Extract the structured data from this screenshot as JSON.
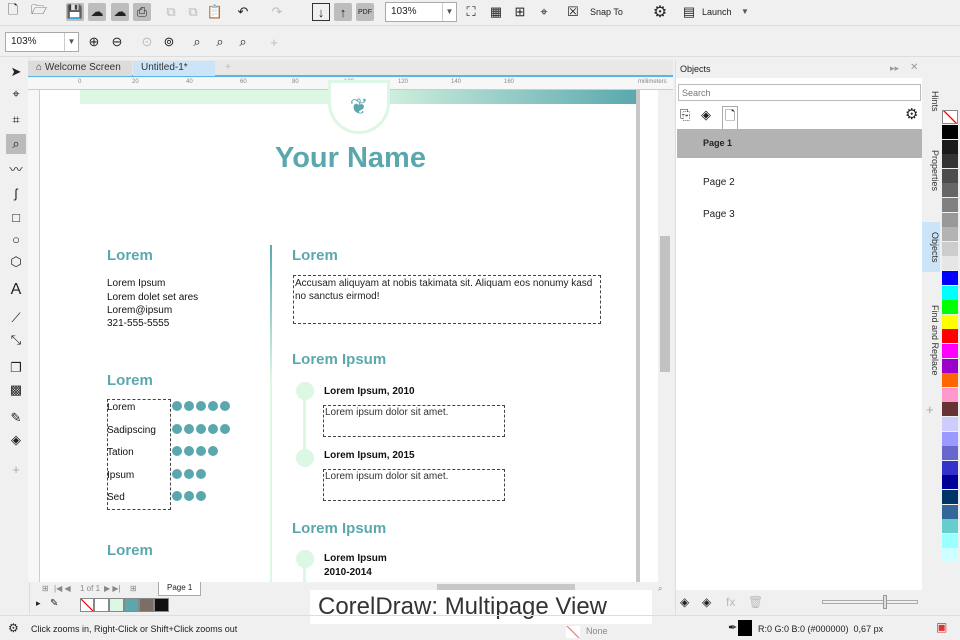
{
  "toolbar": {
    "zoom_value": "103%",
    "snap_to": "Snap To",
    "launch": "Launch",
    "pdf": "PDF"
  },
  "zoombar": {
    "zoom_value": "103%"
  },
  "tabs": [
    {
      "label": "Welcome Screen"
    },
    {
      "label": "Untitled-1*"
    }
  ],
  "ruler": {
    "ticks": [
      "0",
      "20",
      "40",
      "60",
      "80",
      "100",
      "120",
      "140",
      "160"
    ],
    "unit": "millimeters"
  },
  "doc": {
    "name": "Your Name",
    "left_heading1": "Lorem",
    "contact": [
      "Lorem Ipsum",
      "Lorem dolet set ares",
      "Lorem@ipsum",
      "321-555-5555"
    ],
    "left_heading2": "Lorem",
    "skills": [
      {
        "label": "Lorem",
        "level": 5
      },
      {
        "label": "Sadipscing",
        "level": 5
      },
      {
        "label": "Tation",
        "level": 4
      },
      {
        "label": "Ipsum",
        "level": 3
      },
      {
        "label": "Sed",
        "level": 3
      }
    ],
    "left_heading3": "Lorem",
    "right_heading1": "Lorem",
    "intro": "Accusam aliquyam at nobis takimata sit. Aliquam eos nonumy kasd no sanctus eirmod!",
    "right_heading2": "Lorem Ipsum",
    "entries": [
      {
        "title": "Lorem Ipsum, 2010",
        "text": "Lorem ipsum dolor sit amet."
      },
      {
        "title": "Lorem Ipsum, 2015",
        "text": "Lorem ipsum dolor sit amet."
      }
    ],
    "right_heading3": "Lorem Ipsum",
    "entry3_title": "Lorem Ipsum",
    "entry3_years": "2010-2014"
  },
  "pagenav": {
    "counter": "1 of 1",
    "page_tab": "Page 1"
  },
  "objects": {
    "title": "Objects",
    "search_placeholder": "Search",
    "pages": [
      "Page 1",
      "Page 2",
      "Page 3"
    ]
  },
  "side_tabs": [
    "Hints",
    "Properties",
    "Objects",
    "Find and Replace"
  ],
  "status": {
    "hint": "Click zooms in, Right-Click or Shift+Click zooms out",
    "fill": "None",
    "outline": "R:0 G:0 B:0 (#000000)  0,67 px"
  },
  "caption": "CorelDraw: Multipage View",
  "colors": {
    "accent": "#5aa8ae",
    "mint": "#dcf7e3",
    "selected_row": "#b3b3b3"
  },
  "palette": [
    "#000000",
    "#1a1a1a",
    "#333333",
    "#4d4d4d",
    "#666666",
    "#808080",
    "#999999",
    "#b3b3b3",
    "#cccccc",
    "#e6e6e6",
    "#0000ff",
    "#00ffff",
    "#00ff00",
    "#ffff00",
    "#ff0000",
    "#ff00ff",
    "#9900cc",
    "#ff6600",
    "#ff99cc",
    "#663333",
    "#ccccff",
    "#9999ff",
    "#6666cc",
    "#3333cc",
    "#000099",
    "#003366",
    "#336699",
    "#66cccc",
    "#99ffff",
    "#ccffff"
  ],
  "doc_palette": [
    "#ffffff",
    "#dcf7e3",
    "#5aa8ae",
    "#7a6e66",
    "#111111"
  ]
}
